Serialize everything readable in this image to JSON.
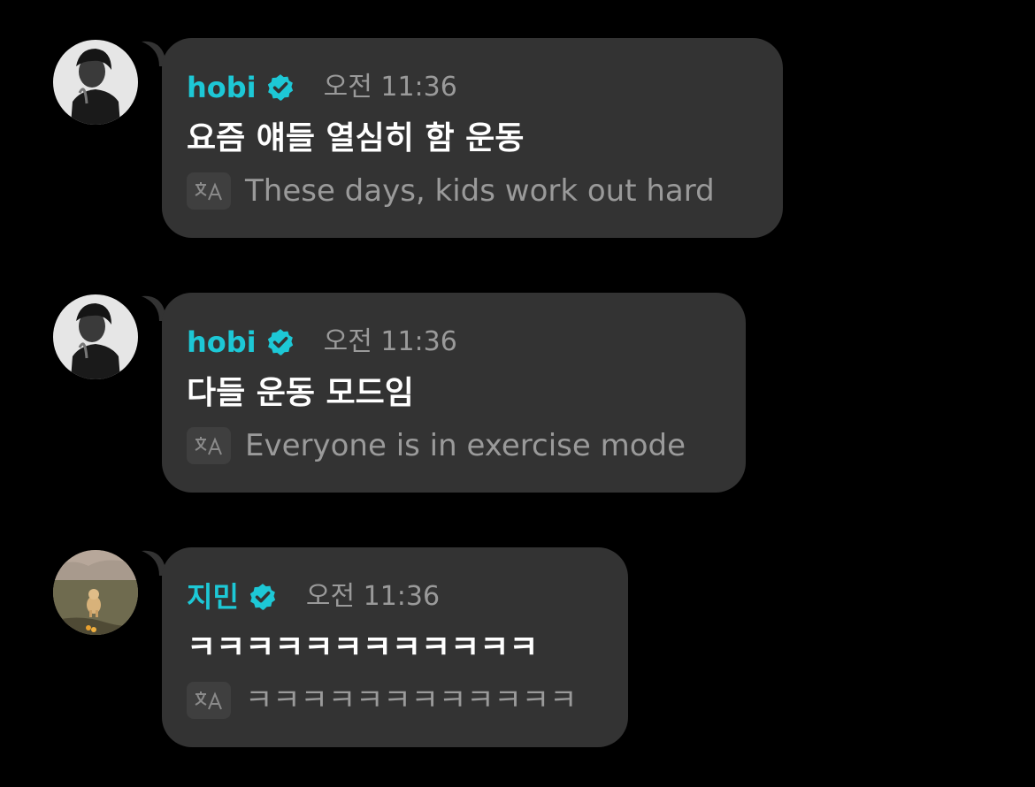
{
  "colors": {
    "background": "#000000",
    "bubble": "#333333",
    "username": "#1dc8d6",
    "verified": "#1dc8d6",
    "message_text": "#ffffff",
    "muted_text": "#9a9a9a"
  },
  "messages": [
    {
      "user": "hobi",
      "verified": true,
      "time": "오전 11:36",
      "text": "요즘 얘들 열심히 함 운동",
      "translation": "These days, kids work out hard",
      "avatar_icon": "profile-photo-grayscale"
    },
    {
      "user": "hobi",
      "verified": true,
      "time": "오전 11:36",
      "text": "다들 운동 모드임",
      "translation": "Everyone is in exercise mode",
      "avatar_icon": "profile-photo-grayscale"
    },
    {
      "user": "지민",
      "verified": true,
      "time": "오전 11:36",
      "text": "ㅋㅋㅋㅋㅋㅋㅋㅋㅋㅋㅋㅋ",
      "translation": "ㅋㅋㅋㅋㅋㅋㅋㅋㅋㅋㅋㅋ",
      "avatar_icon": "profile-photo-dog"
    }
  ]
}
